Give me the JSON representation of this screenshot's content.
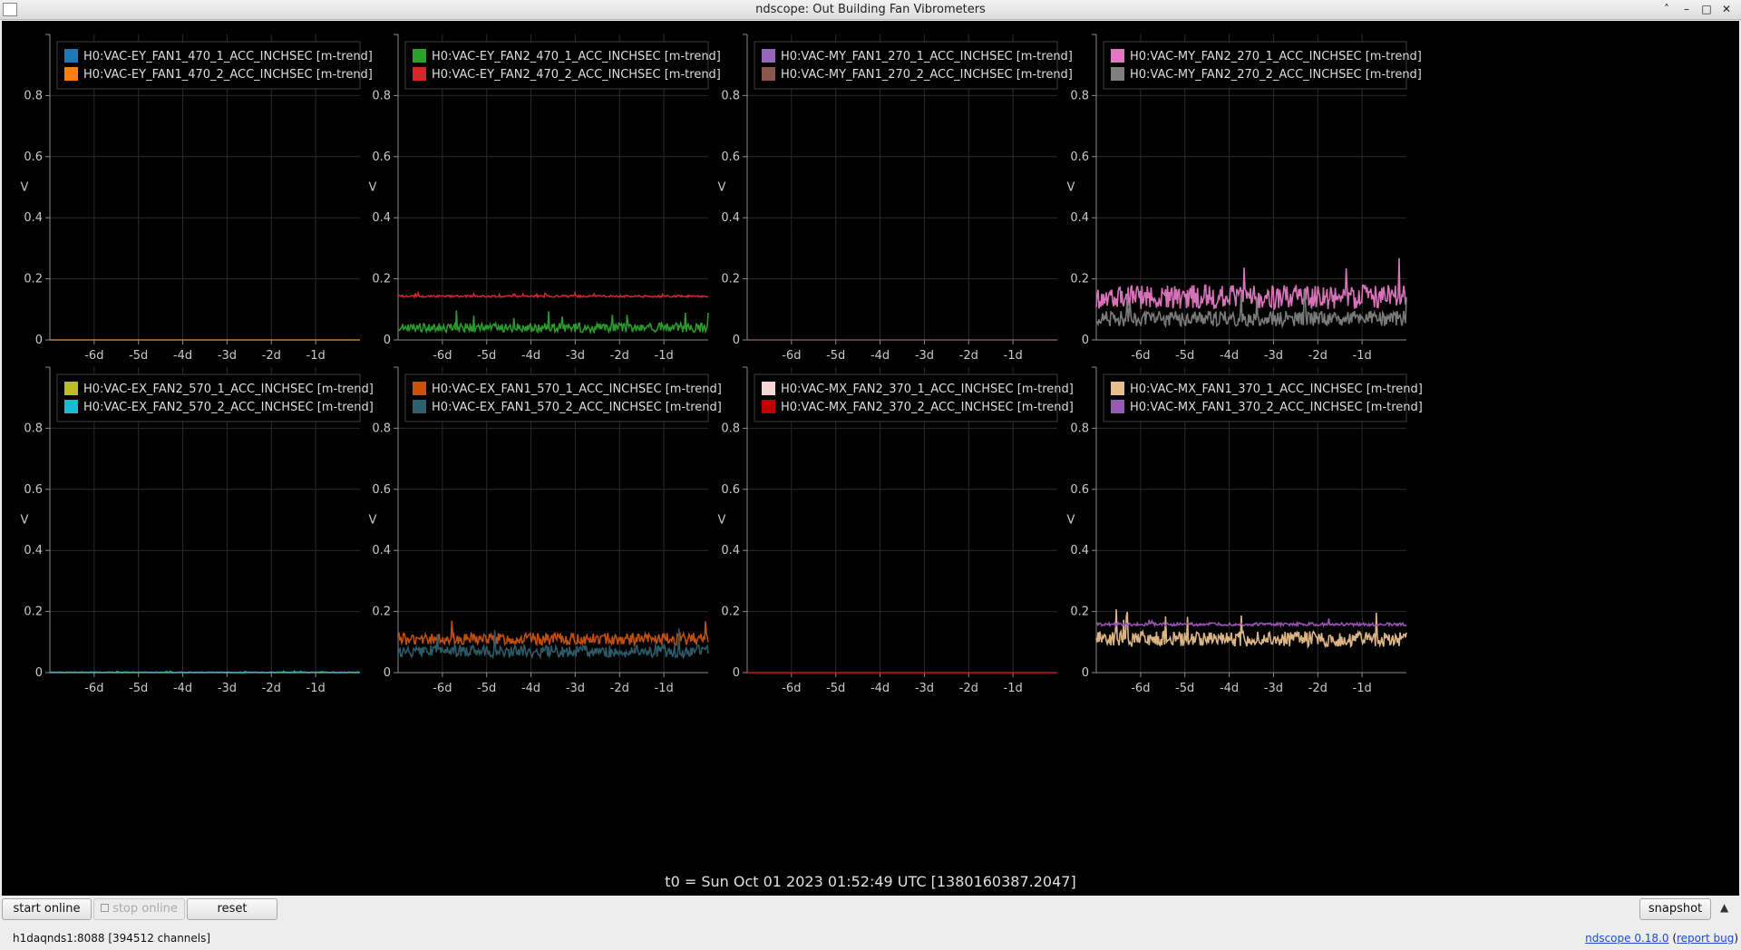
{
  "window": {
    "title": "ndscope: Out Building Fan Vibrometers",
    "minimize_icon": "chevron-up-icon",
    "buttons": [
      "minimize-icon",
      "maximize-icon",
      "close-icon"
    ]
  },
  "toolbar": {
    "start_online_label": "start online",
    "stop_online_label": "stop online",
    "reset_label": "reset",
    "snapshot_label": "snapshot"
  },
  "status": {
    "server": "h1daqnds1:8088  [394512 channels]",
    "version_link": "ndscope 0.18.0",
    "report_bug_link": "report bug"
  },
  "t0_label": "t0 = Sun Oct 01 2023 01:52:49 UTC [1380160387.2047]",
  "chart_data": [
    {
      "type": "line",
      "ylabel": "V",
      "ylim": [
        0,
        1
      ],
      "xlim": [
        -7,
        0
      ],
      "xticks": [
        "-6d",
        "-5d",
        "-4d",
        "-3d",
        "-2d",
        "-1d"
      ],
      "yticks": [
        "0",
        "0.2",
        "0.4",
        "0.6",
        "0.8"
      ],
      "grid": true,
      "legend": "top-left",
      "series": [
        {
          "name": "H0:VAC-EY_FAN1_470_1_ACC_INCHSEC [m-trend]",
          "color": "#1f77b4",
          "mean": 0.0,
          "spread": 0.0
        },
        {
          "name": "H0:VAC-EY_FAN1_470_2_ACC_INCHSEC [m-trend]",
          "color": "#ff7f0e",
          "mean": 0.0,
          "spread": 0.0
        }
      ]
    },
    {
      "type": "line",
      "ylabel": "V",
      "ylim": [
        0,
        1
      ],
      "xlim": [
        -7,
        0
      ],
      "xticks": [
        "-6d",
        "-5d",
        "-4d",
        "-3d",
        "-2d",
        "-1d"
      ],
      "yticks": [
        "0",
        "0.2",
        "0.4",
        "0.6",
        "0.8"
      ],
      "grid": true,
      "legend": "top-left",
      "series": [
        {
          "name": "H0:VAC-EY_FAN2_470_1_ACC_INCHSEC [m-trend]",
          "color": "#2ca02c",
          "mean": 0.04,
          "spread": 0.015
        },
        {
          "name": "H0:VAC-EY_FAN2_470_2_ACC_INCHSEC [m-trend]",
          "color": "#d62728",
          "mean": 0.143,
          "spread": 0.003
        }
      ]
    },
    {
      "type": "line",
      "ylabel": "V",
      "ylim": [
        0,
        1
      ],
      "xlim": [
        -7,
        0
      ],
      "xticks": [
        "-6d",
        "-5d",
        "-4d",
        "-3d",
        "-2d",
        "-1d"
      ],
      "yticks": [
        "0",
        "0.2",
        "0.4",
        "0.6",
        "0.8"
      ],
      "grid": true,
      "legend": "top-left",
      "series": [
        {
          "name": "H0:VAC-MY_FAN1_270_1_ACC_INCHSEC [m-trend]",
          "color": "#9467bd",
          "mean": 0.0,
          "spread": 0.0
        },
        {
          "name": "H0:VAC-MY_FAN1_270_2_ACC_INCHSEC [m-trend]",
          "color": "#8c564b",
          "mean": 0.0,
          "spread": 0.0
        }
      ]
    },
    {
      "type": "line",
      "ylabel": "V",
      "ylim": [
        0,
        1
      ],
      "xlim": [
        -7,
        0
      ],
      "xticks": [
        "-6d",
        "-5d",
        "-4d",
        "-3d",
        "-2d",
        "-1d"
      ],
      "yticks": [
        "0",
        "0.2",
        "0.4",
        "0.6",
        "0.8"
      ],
      "grid": true,
      "legend": "top-left",
      "series": [
        {
          "name": "H0:VAC-MY_FAN2_270_1_ACC_INCHSEC [m-trend]",
          "color": "#e377c2",
          "mean": 0.14,
          "spread": 0.04
        },
        {
          "name": "H0:VAC-MY_FAN2_270_2_ACC_INCHSEC [m-trend]",
          "color": "#7f7f7f",
          "mean": 0.07,
          "spread": 0.025
        }
      ]
    },
    {
      "type": "line",
      "ylabel": "V",
      "ylim": [
        0,
        1
      ],
      "xlim": [
        -7,
        0
      ],
      "xticks": [
        "-6d",
        "-5d",
        "-4d",
        "-3d",
        "-2d",
        "-1d"
      ],
      "yticks": [
        "0",
        "0.2",
        "0.4",
        "0.6",
        "0.8"
      ],
      "grid": true,
      "legend": "top-left",
      "series": [
        {
          "name": "H0:VAC-EX_FAN2_570_1_ACC_INCHSEC [m-trend]",
          "color": "#bcbd22",
          "mean": 0.0,
          "spread": 0.0
        },
        {
          "name": "H0:VAC-EX_FAN2_570_2_ACC_INCHSEC [m-trend]",
          "color": "#17becf",
          "mean": 0.001,
          "spread": 0.001
        }
      ]
    },
    {
      "type": "line",
      "ylabel": "V",
      "ylim": [
        0,
        1
      ],
      "xlim": [
        -7,
        0
      ],
      "xticks": [
        "-6d",
        "-5d",
        "-4d",
        "-3d",
        "-2d",
        "-1d"
      ],
      "yticks": [
        "0",
        "0.2",
        "0.4",
        "0.6",
        "0.8"
      ],
      "grid": true,
      "legend": "top-left",
      "series": [
        {
          "name": "H0:VAC-EX_FAN1_570_1_ACC_INCHSEC [m-trend]",
          "color": "#c8520c",
          "mean": 0.11,
          "spread": 0.02
        },
        {
          "name": "H0:VAC-EX_FAN1_570_2_ACC_INCHSEC [m-trend]",
          "color": "#2d5f6c",
          "mean": 0.07,
          "spread": 0.02
        }
      ]
    },
    {
      "type": "line",
      "ylabel": "V",
      "ylim": [
        0,
        1
      ],
      "xlim": [
        -7,
        0
      ],
      "xticks": [
        "-6d",
        "-5d",
        "-4d",
        "-3d",
        "-2d",
        "-1d"
      ],
      "yticks": [
        "0",
        "0.2",
        "0.4",
        "0.6",
        "0.8"
      ],
      "grid": true,
      "legend": "top-left",
      "series": [
        {
          "name": "H0:VAC-MX_FAN2_370_1_ACC_INCHSEC [m-trend]",
          "color": "#f7d6d6",
          "mean": 0.0,
          "spread": 0.0
        },
        {
          "name": "H0:VAC-MX_FAN2_370_2_ACC_INCHSEC [m-trend]",
          "color": "#c00000",
          "mean": 0.0,
          "spread": 0.0
        }
      ]
    },
    {
      "type": "line",
      "ylabel": "V",
      "ylim": [
        0,
        1
      ],
      "xlim": [
        -7,
        0
      ],
      "xticks": [
        "-6d",
        "-5d",
        "-4d",
        "-3d",
        "-2d",
        "-1d"
      ],
      "yticks": [
        "0",
        "0.2",
        "0.4",
        "0.6",
        "0.8"
      ],
      "grid": true,
      "legend": "top-left",
      "series": [
        {
          "name": "H0:VAC-MX_FAN1_370_1_ACC_INCHSEC [m-trend]",
          "color": "#e8be8a",
          "mean": 0.11,
          "spread": 0.025
        },
        {
          "name": "H0:VAC-MX_FAN1_370_2_ACC_INCHSEC [m-trend]",
          "color": "#9b59b6",
          "mean": 0.158,
          "spread": 0.005
        }
      ]
    }
  ]
}
